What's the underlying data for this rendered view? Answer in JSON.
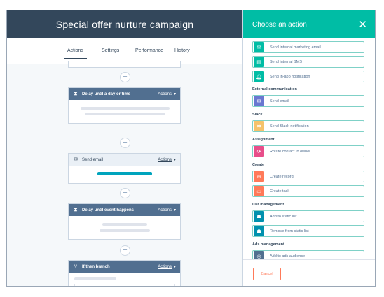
{
  "workflow": {
    "title": "Special offer nurture campaign",
    "tabs": [
      {
        "label": "Actions",
        "active": true
      },
      {
        "label": "Settings",
        "active": false
      },
      {
        "label": "Performance",
        "active": false
      },
      {
        "label": "History",
        "active": false
      }
    ],
    "cards": [
      {
        "title": "Delay until a day or time",
        "actions": "Actions",
        "icon": "hourglass-icon"
      },
      {
        "title": "Send email",
        "actions": "Actions",
        "icon": "email-icon"
      },
      {
        "title": "Delay until event happens",
        "actions": "Actions",
        "icon": "hourglass-icon"
      },
      {
        "title": "If/then branch",
        "actions": "Actions",
        "icon": "branch-icon"
      }
    ],
    "plus": "+"
  },
  "panel": {
    "title": "Choose an action",
    "close": "✕",
    "sections": [
      {
        "heading": "External communication"
      },
      {
        "heading": "Slack"
      },
      {
        "heading": "Assignment"
      },
      {
        "heading": "Create"
      },
      {
        "heading": "List management"
      },
      {
        "heading": "Ads management"
      }
    ],
    "options": [
      {
        "label": "Send internal marketing email",
        "color": "#00bda5",
        "icon": "email-icon"
      },
      {
        "label": "Send internal SMS",
        "color": "#00bda5",
        "icon": "sms-icon"
      },
      {
        "label": "Send in-app notification",
        "color": "#00bda5",
        "icon": "bell-icon"
      },
      {
        "label": "Send email",
        "color": "#6a78d1",
        "icon": "email-icon"
      },
      {
        "label": "Send Slack notification",
        "color": "#f5c26b",
        "icon": "slack-icon"
      },
      {
        "label": "Rotate contact to owner",
        "color": "#e84e8a",
        "icon": "rotate-icon"
      },
      {
        "label": "Create record",
        "color": "#ff7a59",
        "icon": "plus-circle-icon"
      },
      {
        "label": "Create task",
        "color": "#ff7a59",
        "icon": "task-icon"
      },
      {
        "label": "Add to static list",
        "color": "#0091ae",
        "icon": "list-icon"
      },
      {
        "label": "Remove from static list",
        "color": "#0091ae",
        "icon": "list-icon"
      },
      {
        "label": "Add to ads audience",
        "color": "#516f90",
        "icon": "target-icon"
      }
    ],
    "cancel": "Cancel"
  }
}
